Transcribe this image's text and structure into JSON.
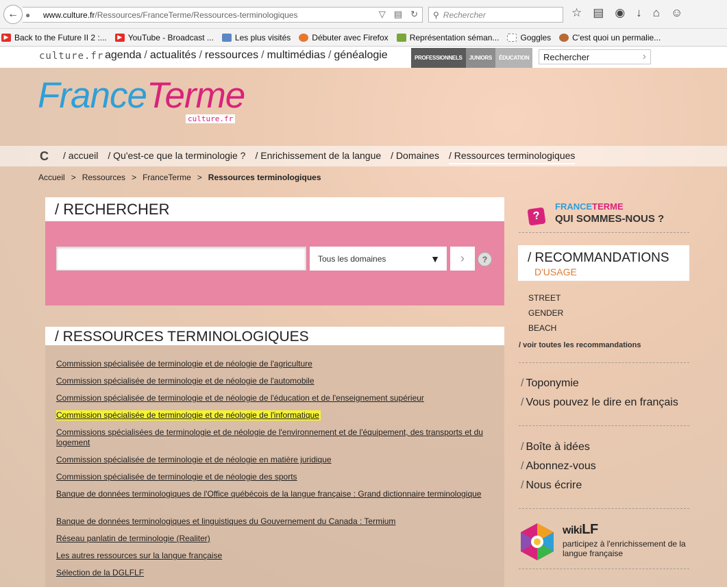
{
  "browser": {
    "url_domain": "www.culture.fr",
    "url_path": "/Ressources/FranceTerme/Ressources-terminologiques",
    "search_placeholder": "Rechercher"
  },
  "bookmarks": [
    {
      "label": "Back to the Future II 2 :...",
      "icon": "youtube-icon",
      "color": "#e52d27"
    },
    {
      "label": "YouTube - Broadcast ...",
      "icon": "youtube-icon",
      "color": "#e52d27"
    },
    {
      "label": "Les plus visités",
      "icon": "page-icon",
      "color": "#5b87c5"
    },
    {
      "label": "Débuter avec Firefox",
      "icon": "firefox-icon",
      "color": "#e6772e"
    },
    {
      "label": "Représentation séman...",
      "icon": "leaf-icon",
      "color": "#7aa63a"
    },
    {
      "label": "Goggles",
      "icon": "blank-page-icon",
      "color": "#aaaaaa"
    },
    {
      "label": "C'est quoi un permalie...",
      "icon": "avatar-icon",
      "color": "#b86a35"
    }
  ],
  "site_header": {
    "logo": "culture.fr",
    "nav": [
      "agenda",
      "actualités",
      "ressources",
      "multimédias",
      "généalogie"
    ],
    "audience_tabs": [
      {
        "label": "PROFESSIONNELS",
        "color": "#5a5a5a"
      },
      {
        "label": "JUNIORS",
        "color": "#8d8d8d"
      },
      {
        "label": "ÉDUCATION",
        "color": "#b4b4b4"
      }
    ],
    "search_placeholder": "Rechercher"
  },
  "franceterme": {
    "logo_part1": "France",
    "logo_part2": "Terme",
    "logo_sub": "culture.fr"
  },
  "section_nav": [
    {
      "label": "/ accueil",
      "active": false
    },
    {
      "label": "/ Qu'est-ce que la terminologie ?",
      "active": false
    },
    {
      "label": "/ Enrichissement de la langue",
      "active": false
    },
    {
      "label": "/ Domaines",
      "active": false
    },
    {
      "label": "/ Ressources terminologiques",
      "active": true
    }
  ],
  "breadcrumb": [
    "Accueil",
    "Ressources",
    "FranceTerme",
    "Ressources terminologiques"
  ],
  "search": {
    "title": "/ RECHERCHER",
    "input_value": "",
    "domain_selected": "Tous les domaines",
    "help": "?"
  },
  "resources": {
    "title": "/ RESSOURCES TERMINOLOGIQUES",
    "links": [
      "Commission spécialisée de terminologie et de néologie de l'agriculture",
      "Commission spécialisée de terminologie et de néologie de l'automobile",
      "Commission spécialisée de terminologie et de néologie de l'éducation et de l'enseignement supérieur",
      "Commission spécialisée de terminologie et de néologie de l'informatique",
      "Commissions spécialisées de terminologie et de néologie de l'environnement et de l'équipement, des transports et du logement",
      "Commission spécialisée de terminologie et de néologie en matière juridique",
      "Commission spécialisée de terminologie et de néologie des sports",
      "Banque de données terminologiques de l'Office québécois de la langue française : Grand dictionnaire terminologique",
      "Banque de données terminologiques et linguistiques du Gouvernement du Canada : Termium",
      "Réseau panlatin de terminologie (Realiter)",
      "Les autres ressources sur la langue française",
      "Sélection de la DGLFLF"
    ]
  },
  "sidebar": {
    "who_brand_1": "FRANCE",
    "who_brand_2": "TERME",
    "who_title": "QUI SOMMES-NOUS ?",
    "reco_title": "/ RECOMMANDATIONS",
    "reco_sub": "D'USAGE",
    "reco_items": [
      "STREET",
      "GENDER",
      "BEACH"
    ],
    "reco_all": "/ voir toutes les recommandations",
    "links_group1": [
      "Toponymie",
      "Vous pouvez le dire en français"
    ],
    "links_group2": [
      "Boîte à idées",
      "Abonnez-vous",
      "Nous écrire"
    ],
    "wikilf_title_1": "wiki",
    "wikilf_title_2": "LF",
    "wikilf_desc": "participez à l'enrichissement de la langue française"
  }
}
